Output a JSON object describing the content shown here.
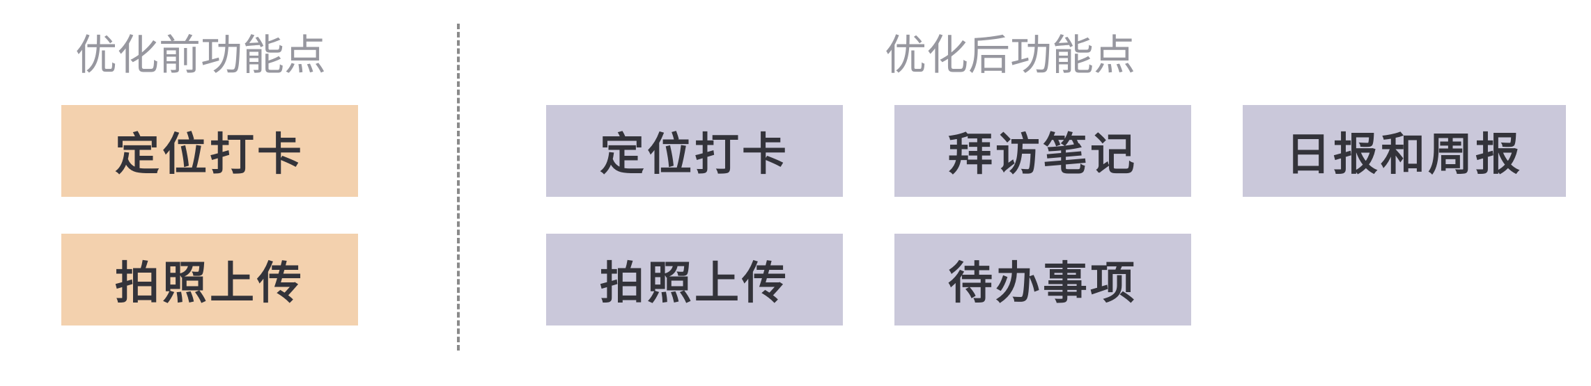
{
  "before": {
    "title": "优化前功能点",
    "items": [
      "定位打卡",
      "拍照上传"
    ]
  },
  "after": {
    "title": "优化后功能点",
    "items": [
      "定位打卡",
      "拍照上传",
      "拜访笔记",
      "待办事项",
      "日报和周报"
    ]
  },
  "colors": {
    "before_box": "#f3d1ae",
    "after_box": "#cac8da",
    "heading_text": "#97979f",
    "box_text": "#33333a"
  }
}
